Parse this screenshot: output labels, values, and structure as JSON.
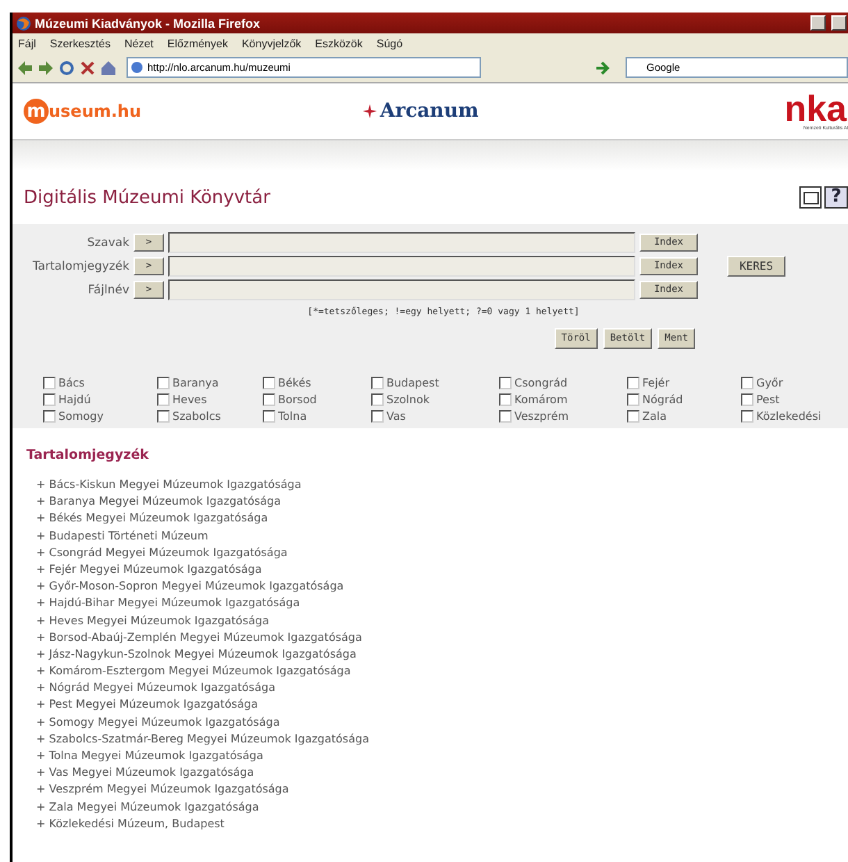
{
  "window": {
    "title": "Múzeumi Kiadványok - Mozilla Firefox"
  },
  "menu": [
    "Fájl",
    "Szerkesztés",
    "Nézet",
    "Előzmények",
    "Könyvjelzők",
    "Eszközök",
    "Súgó"
  ],
  "address_bar": {
    "value": "http://nlo.arcanum.hu/muzeumi"
  },
  "search_bar": {
    "value": "Google"
  },
  "header": {
    "left_logo": {
      "mark": "m",
      "text": "useum.hu"
    },
    "center_logo": {
      "text": "Arcanum"
    },
    "right_logo": {
      "text": "nka",
      "subtitle": "Nemzeti Kulturális Al"
    }
  },
  "page_title": "Digitális Múzeumi Könyvtár",
  "help_button": "?",
  "search_form": {
    "fields": [
      {
        "label": "Szavak",
        "arrow": ">",
        "index_button": "Index"
      },
      {
        "label": "Tartalomjegyzék",
        "arrow": ">",
        "index_button": "Index"
      },
      {
        "label": "Fájlnév",
        "arrow": ">",
        "index_button": "Index"
      }
    ],
    "search_button": "KERES",
    "hint": "[*=tetszőleges; !=egy helyett; ?=0 vagy 1 helyett]",
    "buttons": [
      "Töröl",
      "Betölt",
      "Ment"
    ]
  },
  "filters": [
    {
      "label": "Bács",
      "checked": false
    },
    {
      "label": "Baranya",
      "checked": false
    },
    {
      "label": "Békés",
      "checked": false
    },
    {
      "label": "Budapest",
      "checked": false
    },
    {
      "label": "Csongrád",
      "checked": false
    },
    {
      "label": "Fejér",
      "checked": false
    },
    {
      "label": "Győr",
      "checked": false
    },
    {
      "label": "Hajdú",
      "checked": false
    },
    {
      "label": "Heves",
      "checked": false
    },
    {
      "label": "Borsod",
      "checked": false
    },
    {
      "label": "Szolnok",
      "checked": false
    },
    {
      "label": "Komárom",
      "checked": false
    },
    {
      "label": "Nógrád",
      "checked": false
    },
    {
      "label": "Pest",
      "checked": false
    },
    {
      "label": "Somogy",
      "checked": false
    },
    {
      "label": "Szabolcs",
      "checked": false
    },
    {
      "label": "Tolna",
      "checked": false
    },
    {
      "label": "Vas",
      "checked": false
    },
    {
      "label": "Veszprém",
      "checked": false
    },
    {
      "label": "Zala",
      "checked": false
    },
    {
      "label": "Közlekedési",
      "checked": false
    }
  ],
  "contents": {
    "heading": "Tartalomjegyzék",
    "items": [
      "+ Bács-Kiskun Megyei Múzeumok Igazgatósága",
      "+ Baranya Megyei Múzeumok Igazgatósága",
      "+ Békés Megyei Múzeumok Igazgatósága",
      "+ Budapesti Történeti Múzeum",
      "+ Csongrád Megyei Múzeumok Igazgatósága",
      "+ Fejér Megyei Múzeumok Igazgatósága",
      "+ Győr-Moson-Sopron Megyei Múzeumok Igazgatósága",
      "+ Hajdú-Bihar Megyei Múzeumok Igazgatósága",
      "+ Heves Megyei Múzeumok Igazgatósága",
      "+ Borsod-Abaúj-Zemplén Megyei Múzeumok Igazgatósága",
      "+ Jász-Nagykun-Szolnok Megyei Múzeumok Igazgatósága",
      "+ Komárom-Esztergom Megyei Múzeumok Igazgatósága",
      "+ Nógrád Megyei Múzeumok Igazgatósága",
      "+ Pest Megyei Múzeumok Igazgatósága",
      "+ Somogy Megyei Múzeumok Igazgatósága",
      "+ Szabolcs-Szatmár-Bereg Megyei Múzeumok Igazgatósága",
      "+ Tolna Megyei Múzeumok Igazgatósága",
      "+ Vas Megyei Múzeumok Igazgatósága",
      "+ Veszprém Megyei Múzeumok Igazgatósága",
      "+ Zala Megyei Múzeumok Igazgatósága",
      "+ Közlekedési Múzeum, Budapest"
    ]
  }
}
